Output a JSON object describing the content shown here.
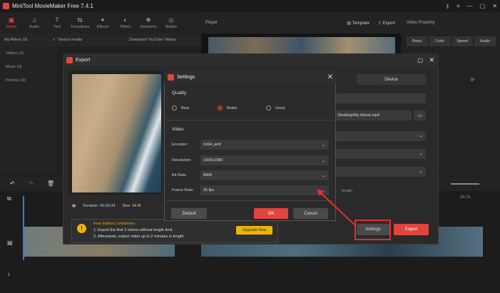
{
  "app": {
    "title": "MiniTool MovieMaker Free 7.4.1"
  },
  "toolbar": {
    "items": [
      {
        "label": "Media",
        "icon": "folder-icon"
      },
      {
        "label": "Audio",
        "icon": "music-icon"
      },
      {
        "label": "Text",
        "icon": "text-icon"
      },
      {
        "label": "Transitions",
        "icon": "transition-icon"
      },
      {
        "label": "Effects",
        "icon": "effects-icon"
      },
      {
        "label": "Filters",
        "icon": "filters-icon"
      },
      {
        "label": "Elements",
        "icon": "elements-icon"
      },
      {
        "label": "Motion",
        "icon": "motion-icon"
      }
    ]
  },
  "media": {
    "album": "My Album (3)",
    "search_placeholder": "Search media",
    "download": "Download YouTube Videos",
    "sidebar": [
      "Videos (3)",
      "Music (0)",
      "Pictures (0)"
    ]
  },
  "player": {
    "title": "Player",
    "template": "Template",
    "export": "Export"
  },
  "video_property": {
    "title": "Video Property",
    "tabs": [
      "Basic",
      "Color",
      "Speed",
      "Audio"
    ],
    "angle": "0°"
  },
  "export_dialog": {
    "title": "Export",
    "device_tab": "Device",
    "path_suffix": "\\Desktop\\My Movie.mp4",
    "duration_label": "Duration:",
    "duration_value": "00:00:34",
    "size_label": "Size:",
    "size_value": "34 M",
    "settings_button": "Settings",
    "export_button": "Export",
    "length_suffix": "length",
    "free": {
      "title": "Free Edition Limitations:",
      "line1": "1. Export the first 3 videos without length limit.",
      "line2": "2. Afterwards, export video up to 2 minutes in length.",
      "upgrade": "Upgrade Now"
    }
  },
  "settings_dialog": {
    "title": "Settings",
    "quality_label": "Quality",
    "quality_options": [
      {
        "label": "Best",
        "selected": false
      },
      {
        "label": "Better",
        "selected": true
      },
      {
        "label": "Good",
        "selected": false
      }
    ],
    "video_label": "Video",
    "fields": [
      {
        "label": "Encoder:",
        "value": "h264_amf"
      },
      {
        "label": "Resolution:",
        "value": "1920x1080"
      },
      {
        "label": "Bit Rate:",
        "value": "8000"
      },
      {
        "label": "Frame Rate:",
        "value": "25 fps"
      }
    ],
    "default_button": "Default",
    "ok_button": "OK",
    "cancel_button": "Cancel"
  },
  "timeline": {
    "time_marker": "34.0s"
  },
  "colors": {
    "accent": "#e2453c",
    "highlight": "#e2302a",
    "warning": "#f0b400"
  }
}
